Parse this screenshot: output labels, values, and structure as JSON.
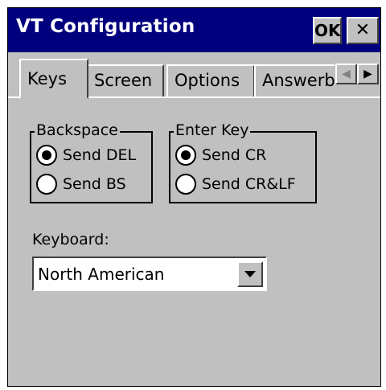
{
  "window": {
    "title": "VT Configuration",
    "ok_label": "OK",
    "close_label": "✕"
  },
  "tabs": [
    {
      "label": "Keys",
      "active": true
    },
    {
      "label": "Screen",
      "active": false
    },
    {
      "label": "Options",
      "active": false
    },
    {
      "label": "Answerb",
      "active": false
    }
  ],
  "tab_scroll": {
    "left_icon": "◀",
    "right_icon": "▶"
  },
  "backspace": {
    "group_label": "Backspace",
    "options": [
      {
        "label": "Send DEL",
        "selected": true
      },
      {
        "label": "Send BS",
        "selected": false
      }
    ]
  },
  "enter_key": {
    "group_label": "Enter Key",
    "options": [
      {
        "label": "Send CR",
        "selected": true
      },
      {
        "label": "Send CR&LF",
        "selected": false
      }
    ]
  },
  "keyboard": {
    "label": "Keyboard:",
    "selected": "North American"
  },
  "colors": {
    "titlebar": "#00007f",
    "dialog_bg": "#c0c0c0"
  }
}
